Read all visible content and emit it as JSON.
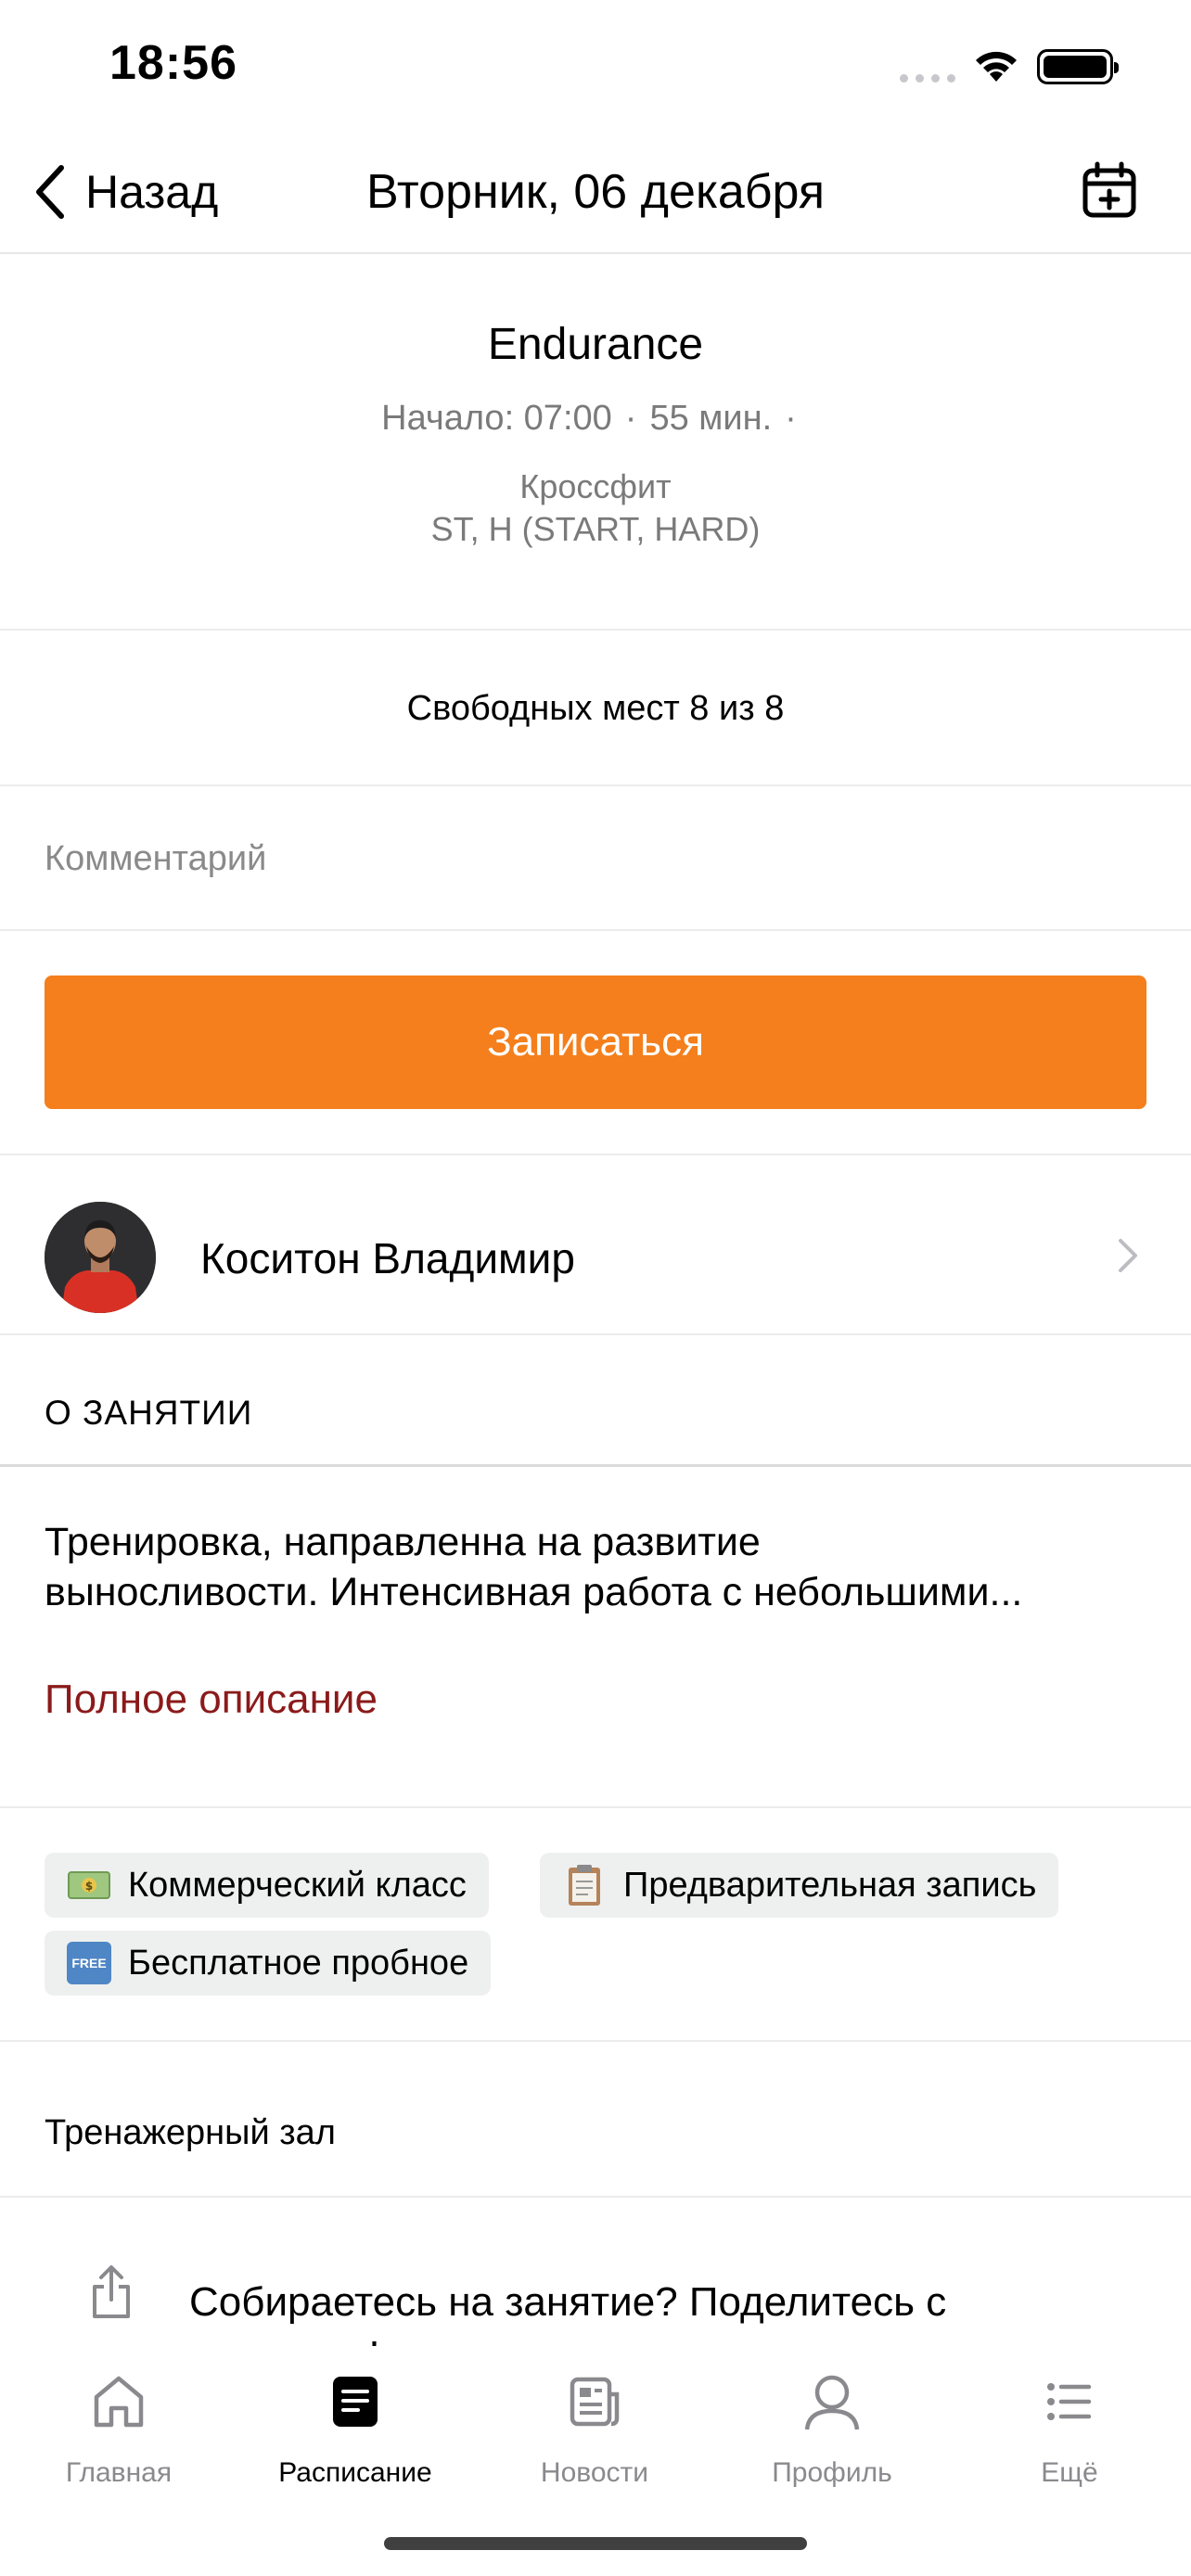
{
  "status_bar": {
    "time": "18:56"
  },
  "nav": {
    "back_label": "Назад",
    "title": "Вторник, 06 декабря",
    "add_to_calendar_icon": "calendar-plus-icon"
  },
  "class_info": {
    "title": "Endurance",
    "start": "Начало: 07:00",
    "duration": "55 мин.",
    "separator": "·",
    "category": "Кроссфит",
    "level": "ST, H (START, HARD)"
  },
  "slots": {
    "text": "Свободных мест 8 из 8"
  },
  "comment": {
    "placeholder": "Комментарий",
    "value": ""
  },
  "signup": {
    "label": "Записаться",
    "color": "#f47f1c"
  },
  "coach": {
    "name": "Коситон Владимир"
  },
  "about": {
    "header": "О ЗАНЯТИИ",
    "line1": "Тренировка, направленна на развитие",
    "line2": "выносливости. Интенсивная работа с небольшими...",
    "full_link": "Полное описание",
    "link_color": "#8b1a1a"
  },
  "tags": [
    {
      "label": "Коммерческий класс",
      "icon": "money-icon"
    },
    {
      "label": "Предварительная запись",
      "icon": "clipboard-icon"
    },
    {
      "label": "Бесплатное пробное",
      "icon": "free-icon",
      "icon_text": "FREE"
    }
  ],
  "hall": {
    "label": "Тренажерный зал"
  },
  "share": {
    "text": "Собираетесь на занятие? Поделитесь с друзьями!"
  },
  "tabbar": {
    "items": [
      {
        "label": "Главная",
        "icon": "home-icon",
        "active": false
      },
      {
        "label": "Расписание",
        "icon": "schedule-icon",
        "active": true
      },
      {
        "label": "Новости",
        "icon": "news-icon",
        "active": false
      },
      {
        "label": "Профиль",
        "icon": "profile-icon",
        "active": false
      },
      {
        "label": "Ещё",
        "icon": "more-icon",
        "active": false
      }
    ]
  }
}
